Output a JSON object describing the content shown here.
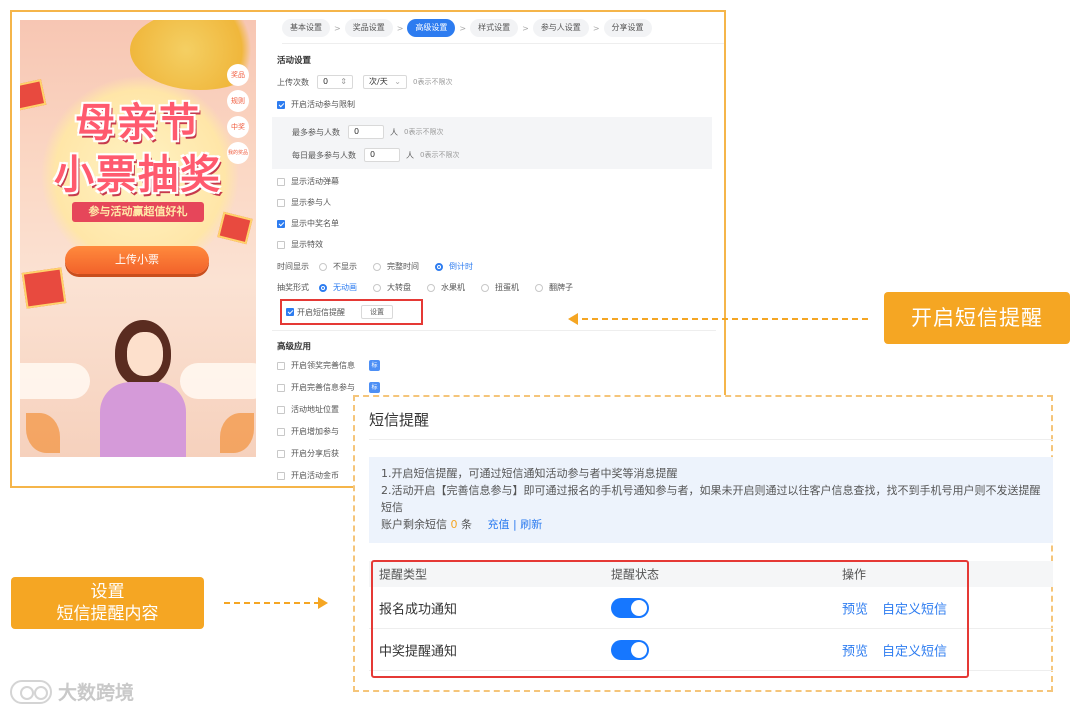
{
  "preview": {
    "title_line1": "母亲节",
    "title_line2": "小票抽奖",
    "ribbon": "参与活动赢超值好礼",
    "button": "上传小票",
    "side_icons": [
      "奖品",
      "规则",
      "中奖",
      "我的奖品"
    ]
  },
  "steps": [
    "基本设置",
    "奖品设置",
    "高级设置",
    "样式设置",
    "参与人设置",
    "分享设置"
  ],
  "activity": {
    "section_title": "活动设置",
    "upload_label": "上传次数",
    "upload_value": "0",
    "upload_unit": "次/天",
    "upload_hint": "0表示不限次",
    "limit_label": "开启活动参与限制",
    "max_participants_label": "最多参与人数",
    "max_participants_value": "0",
    "daily_max_label": "每日最多参与人数",
    "daily_max_value": "0",
    "person_unit": "人",
    "unlimited_hint": "0表示不限次",
    "checkboxes": [
      {
        "label": "显示活动弹幕",
        "checked": false
      },
      {
        "label": "显示参与人",
        "checked": false
      },
      {
        "label": "显示中奖名单",
        "checked": true
      },
      {
        "label": "显示特效",
        "checked": false
      }
    ],
    "time_label": "时间显示",
    "time_options": [
      "不显示",
      "完整时间",
      "倒计时"
    ],
    "time_selected": "倒计时",
    "lottery_label": "抽奖形式",
    "lottery_options": [
      "无动画",
      "大转盘",
      "水果机",
      "扭蛋机",
      "翻牌子"
    ],
    "lottery_selected": "无动画",
    "sms_label": "开启短信提醒",
    "sms_button": "设置"
  },
  "advanced": {
    "section_title": "高级应用",
    "items": [
      "开启领奖完善信息",
      "开启完善信息参与",
      "活动地址位置",
      "开启增加参与",
      "开启分享后获",
      "开启活动金币"
    ],
    "badge": "标"
  },
  "callouts": {
    "top": "开启短信提醒",
    "left_line1": "设置",
    "left_line2": "短信提醒内容"
  },
  "sms_dialog": {
    "title": "短信提醒",
    "info_line1": "1.开启短信提醒，可通过短信通知活动参与者中奖等消息提醒",
    "info_line2": "2.活动开启【完善信息参与】即可通过报名的手机号通知参与者，如果未开启则通过以往客户信息查找，找不到手机号用户则不发送提醒短信",
    "balance_prefix": "账户剩余短信",
    "balance_value": "0",
    "balance_unit": "条",
    "recharge": "充值",
    "separator": "|",
    "refresh": "刷新",
    "columns": [
      "提醒类型",
      "提醒状态",
      "操作"
    ],
    "rows": [
      {
        "type": "报名成功通知",
        "enabled": true,
        "preview": "预览",
        "custom": "自定义短信"
      },
      {
        "type": "中奖提醒通知",
        "enabled": true,
        "preview": "预览",
        "custom": "自定义短信"
      }
    ]
  },
  "watermark": "大数跨境",
  "colors": {
    "accent": "#f5a623",
    "primary": "#2d7cf0",
    "highlight": "#e53935"
  }
}
